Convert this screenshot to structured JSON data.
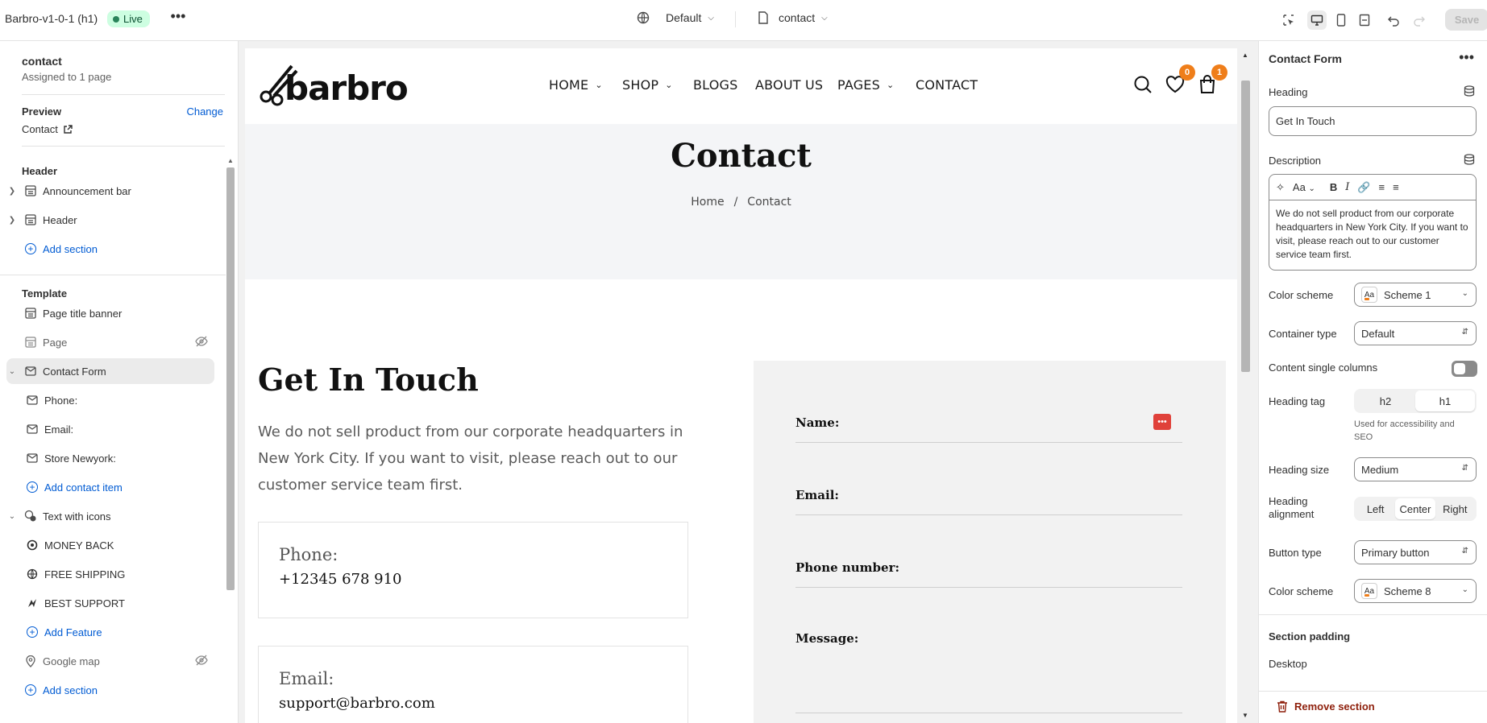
{
  "topbar": {
    "theme_name": "Barbro-v1-0-1 (h1)",
    "live_label": "Live",
    "theme_selector": "Default",
    "page_selector": "contact",
    "save_label": "Save"
  },
  "left_panel": {
    "title": "contact",
    "subtitle": "Assigned to 1 page",
    "preview_label": "Preview",
    "change_label": "Change",
    "preview_page": "Contact",
    "header_group": "Header",
    "template_group": "Template",
    "items": [
      {
        "label": "Announcement bar",
        "icon": "section-icon"
      },
      {
        "label": "Header",
        "icon": "section-icon"
      },
      {
        "label": "Add section"
      },
      {
        "label": "Page title banner",
        "icon": "section-icon"
      },
      {
        "label": "Page",
        "icon": "section-icon"
      },
      {
        "label": "Contact Form",
        "icon": "envelope-icon"
      },
      {
        "label": "Phone:",
        "icon": "envelope-icon"
      },
      {
        "label": "Email:",
        "icon": "envelope-icon"
      },
      {
        "label": "Store Newyork:",
        "icon": "envelope-icon"
      },
      {
        "label": "Add contact item"
      },
      {
        "label": "Text with icons",
        "icon": "features-icon"
      },
      {
        "label": "MONEY BACK",
        "icon": "feature-icon"
      },
      {
        "label": "FREE SHIPPING",
        "icon": "feature-icon"
      },
      {
        "label": "BEST SUPPORT",
        "icon": "feature-icon"
      },
      {
        "label": "Add Feature"
      },
      {
        "label": "Google map",
        "icon": "map-pin-icon"
      },
      {
        "label": "Add section"
      }
    ]
  },
  "storefront": {
    "logo_text": "barbro",
    "nav": [
      {
        "label": "HOME",
        "dropdown": true
      },
      {
        "label": "SHOP",
        "dropdown": true
      },
      {
        "label": "BLOGS",
        "dropdown": false
      },
      {
        "label": "ABOUT US",
        "dropdown": false
      },
      {
        "label": "PAGES",
        "dropdown": true
      },
      {
        "label": "CONTACT",
        "dropdown": false
      }
    ],
    "wishlist_count": "0",
    "cart_count": "1",
    "banner_title": "Contact",
    "breadcrumb": {
      "home": "Home",
      "separator": "/",
      "current": "Contact"
    },
    "heading": "Get In Touch",
    "description": "We do not sell product from our corporate headquarters in New York City. If you want to visit, please reach out to our customer service team first.",
    "contact_items": [
      {
        "label": "Phone:",
        "value": "+12345 678 910"
      },
      {
        "label": "Email:",
        "value": "support@barbro.com"
      }
    ],
    "form_fields": [
      "Name:",
      "Email:",
      "Phone number:",
      "Message:"
    ],
    "accent_color": "#ef7e1a"
  },
  "right_panel": {
    "title": "Contact Form",
    "heading_label": "Heading",
    "heading_value": "Get In Touch",
    "description_label": "Description",
    "description_value": "We do not sell product from our corporate headquarters in New York City. If you want to visit, please reach out to our customer service team first.",
    "rte_font_label": "Aa",
    "color_scheme_label": "Color scheme",
    "color_scheme_value": "Scheme 1",
    "container_type_label": "Container type",
    "container_type_value": "Default",
    "single_columns_label": "Content single columns",
    "heading_tag_label": "Heading tag",
    "heading_tag_options": [
      "h2",
      "h1"
    ],
    "heading_tag_selected": "h1",
    "heading_tag_help": "Used for accessibility and SEO",
    "heading_size_label": "Heading size",
    "heading_size_value": "Medium",
    "heading_alignment_label": "Heading alignment",
    "heading_alignment_options": [
      "Left",
      "Center",
      "Right"
    ],
    "heading_alignment_selected": "Center",
    "button_type_label": "Button type",
    "button_type_value": "Primary button",
    "color_scheme2_label": "Color scheme",
    "color_scheme2_value": "Scheme 8",
    "section_padding_label": "Section padding",
    "desktop_label": "Desktop",
    "remove_label": "Remove section"
  }
}
